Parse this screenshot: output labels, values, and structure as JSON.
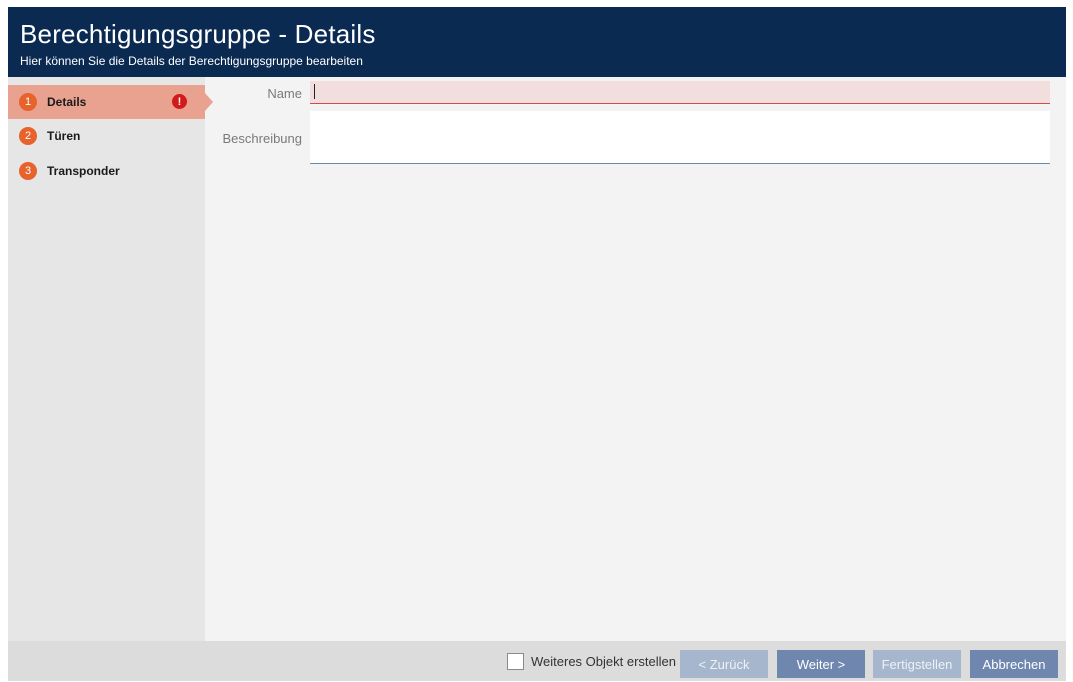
{
  "header": {
    "title": "Berechtigungsgruppe - Details",
    "subtitle": "Hier können Sie die Details der Berechtigungsgruppe bearbeiten"
  },
  "steps": [
    {
      "number": "1",
      "label": "Details",
      "active": true,
      "has_error": true
    },
    {
      "number": "2",
      "label": "Türen",
      "active": false,
      "has_error": false
    },
    {
      "number": "3",
      "label": "Transponder",
      "active": false,
      "has_error": false
    }
  ],
  "error_icon_glyph": "!",
  "form": {
    "name_label": "Name",
    "name_value": "",
    "description_label": "Beschreibung",
    "description_value": ""
  },
  "footer": {
    "checkbox_label": "Weiteres Objekt erstellen",
    "checkbox_checked": false,
    "back_label": "< Zurück",
    "next_label": "Weiter >",
    "finish_label": "Fertigstellen",
    "cancel_label": "Abbrechen"
  },
  "colors": {
    "header_bg": "#0b2a52",
    "active_step_bg": "#e9a28f",
    "step_badge": "#e8622c",
    "error": "#d21a1a",
    "button_primary": "#6f86ae",
    "button_disabled": "#a6b6cd"
  }
}
